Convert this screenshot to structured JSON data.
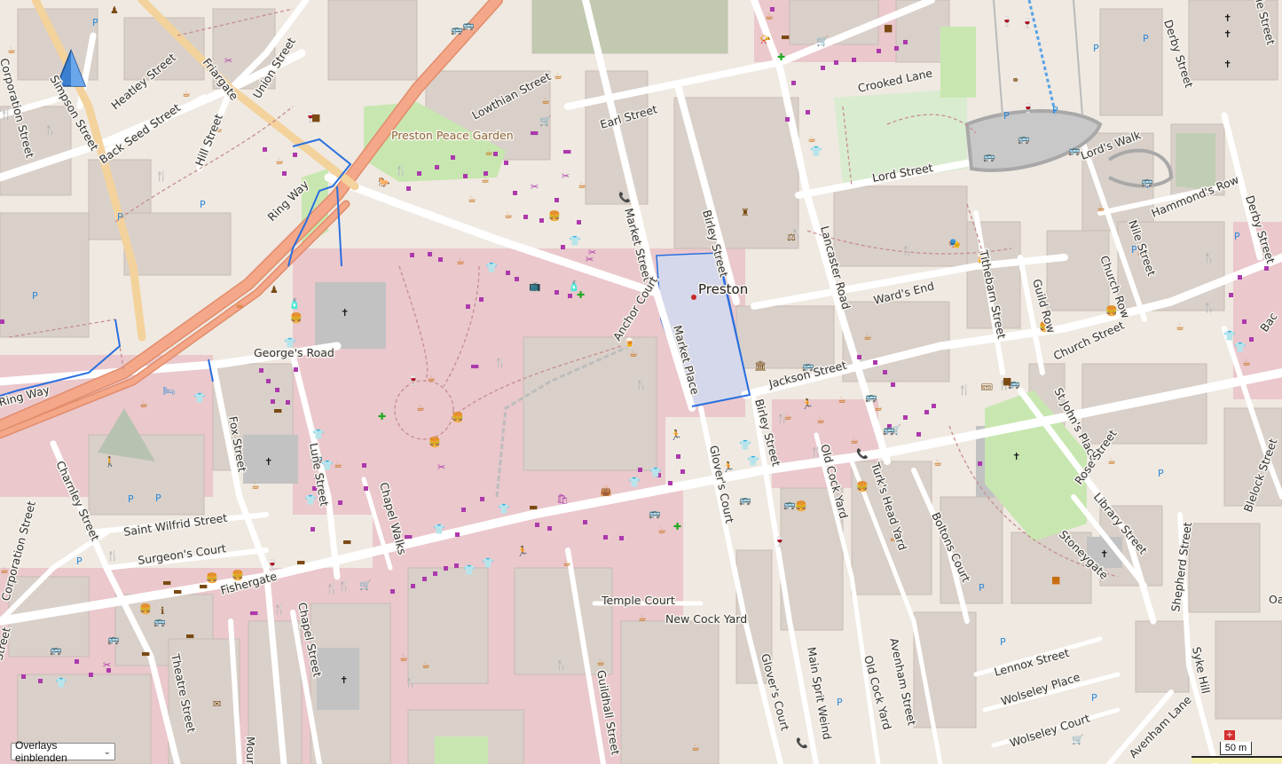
{
  "map": {
    "city": "Preston",
    "park": "Preston Peace Garden",
    "streets": {
      "corporation_street_top": "Corporation Street",
      "simpson_street": "Simpson Street",
      "heatley_street": "Heatley Street",
      "back_seed_street": "Back Seed Street",
      "friargate": "Friargate",
      "union_street": "Union Street",
      "hill_street": "Hill Street",
      "ring_way": "Ring Way",
      "ring_way_left": "Ring Way",
      "lowthian_street": "Lowthian Street",
      "earl_street": "Earl Street",
      "crooked_lane": "Crooked Lane",
      "lord_street": "Lord Street",
      "lords_walk": "Lord's Walk",
      "derby_street_top": "Derby Street",
      "derby_street_right": "Derby Street",
      "hammonds_row": "Hammond's Row",
      "market_street": "Market Street",
      "birley_street_top": "Birley Street",
      "lancaster_road": "Lancaster Road",
      "nile_street": "Nile Street",
      "church_row": "Church Row",
      "wards_end": "Ward's End",
      "tithebarn_street": "Tithebarn Street",
      "guild_row": "Guild Row",
      "church_street": "Church Street",
      "anchor_court": "Anchor Court",
      "market_place": "Market Place",
      "georges_road": "George's Road",
      "jackson_street": "Jackson Street",
      "birley_street_low": "Birley Street",
      "fox_street": "Fox Street",
      "lune_street": "Lune Street",
      "chapel_walks": "Chapel Walks",
      "old_cock_yard_top": "Old Cock Yard",
      "turks_head_yard": "Turk's Head Yard",
      "st_johns_place": "St John's Place",
      "rose_street": "Rose Street",
      "bolton_court": "Boltons Court",
      "library_street": "Library Street",
      "stoneygate": "Stoneygate",
      "shepherd_street": "Shepherd Street",
      "blelock_street": "Blelock Street",
      "glovers_court_top": "Glover's Court",
      "charnley_street": "Charnley Street",
      "saint_wilfrid_street": "Saint Wilfrid Street",
      "surgeons_court": "Surgeon's Court",
      "corporation_street_low": "Corporation Street",
      "fishergate": "Fishergate",
      "temple_court": "Temple Court",
      "new_cock_yard": "New Cock Yard",
      "chapel_street": "Chapel Street",
      "theatre_street": "Theatre Street",
      "guildhall_street": "Guildhall Street",
      "glovers_court_low": "Glover's Court",
      "main_sprit_weind": "Main Sprit Weind",
      "old_cock_yard_low": "Old Cock Yard",
      "avenham_street": "Avenham Street",
      "lennox_street": "Lennox Street",
      "wolseley_place": "Wolseley Place",
      "wolseley_court": "Wolseley Court",
      "avenham_lane": "Avenham Lane",
      "syke_hill": "Syke Hill",
      "street_left_edge": "Street",
      "mount_partial": "Moun",
      "oa_partial": "Oa",
      "bac_partial": "Bac",
      "le_street_partial": "le Street"
    }
  },
  "controls": {
    "overlay_select": "Overlays einblenden",
    "scale": "50 m"
  },
  "colors": {
    "background": "#efe9e1",
    "building": "#d9d0c9",
    "pedestrian_pink": "#eac8cc",
    "primary_road": "#f4a889",
    "green": "#c8e7b0",
    "park_green": "#b7dea0",
    "poi_orange": "#c86e12",
    "poi_magenta": "#ac39ac",
    "route_blue": "#2a6fe0",
    "market_place": "#d5d8ea"
  }
}
